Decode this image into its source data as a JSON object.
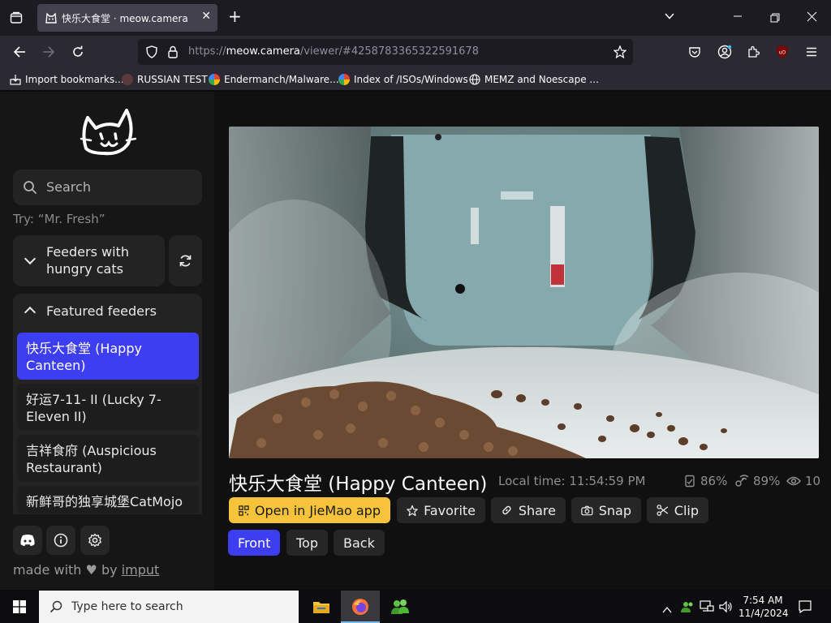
{
  "browser": {
    "tab_title": "快乐大食堂 · meow.camera",
    "url_prefix": "https://",
    "url_host": "meow.camera",
    "url_path": "/viewer/#4258783365322591678",
    "bookmarks": [
      {
        "label": "Import bookmarks..."
      },
      {
        "label": "RUSSIAN TEST"
      },
      {
        "label": "Endermanch/Malware..."
      },
      {
        "label": "Index of /ISOs/Windows"
      },
      {
        "label": "MEMZ and Noescape ..."
      }
    ]
  },
  "sidebar": {
    "search_placeholder": "Search",
    "search_hint": "Try: “Mr. Fresh”",
    "hungry_label": "Feeders with hungry cats",
    "featured_label": "Featured feeders",
    "feeders": [
      {
        "label": "快乐大食堂 (Happy Canteen)"
      },
      {
        "label": "好运7-11- II (Lucky 7-Eleven II)"
      },
      {
        "label": "吉祥食府 (Auspicious Restaurant)"
      },
      {
        "label": "新鲜哥的独享城堡CatMojo (Mr. Fresh's Castle)"
      }
    ],
    "footer_prefix": "made with",
    "footer_by": "by",
    "footer_link": "imput"
  },
  "viewer": {
    "title": "快乐大食堂 (Happy Canteen)",
    "local_time": "Local time: 11:54:59 PM",
    "food_level": "86%",
    "signal": "89%",
    "viewers": "10",
    "buttons": {
      "open_app": "Open in JieMao app",
      "favorite": "Favorite",
      "share": "Share",
      "snap": "Snap",
      "clip": "Clip"
    },
    "cameras": [
      "Front",
      "Top",
      "Back"
    ],
    "selected_camera": "Front"
  },
  "taskbar": {
    "search_placeholder": "Type here to search",
    "time": "7:54 AM",
    "date": "11/4/2024"
  },
  "colors": {
    "accent_blue": "#3d3ef2",
    "accent_yellow": "#f6c33b"
  }
}
